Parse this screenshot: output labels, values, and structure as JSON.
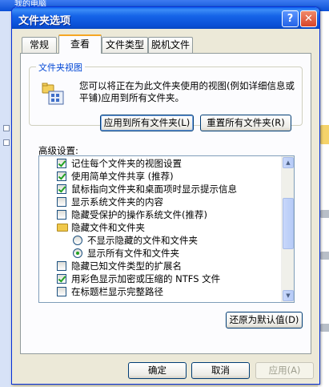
{
  "background": {
    "title": "我的电脑"
  },
  "dialog": {
    "title": "文件夹选项",
    "help_label": "?",
    "close_label": "✕"
  },
  "tabs": [
    {
      "label": "常规"
    },
    {
      "label": "查看"
    },
    {
      "label": "文件类型"
    },
    {
      "label": "脱机文件"
    }
  ],
  "folder_view": {
    "legend": "文件夹视图",
    "description": "您可以将正在为此文件夹使用的视图(例如详细信息或平铺)应用到所有文件夹。",
    "apply_all_label": "应用到所有文件夹(L)",
    "reset_all_label": "重置所有文件夹(R)"
  },
  "advanced": {
    "label": "高级设置:",
    "items": [
      {
        "kind": "checkbox",
        "checked": true,
        "text": "记住每个文件夹的视图设置"
      },
      {
        "kind": "checkbox",
        "checked": true,
        "text": "使用简单文件共享 (推荐)"
      },
      {
        "kind": "checkbox",
        "checked": true,
        "text": "鼠标指向文件夹和桌面项时显示提示信息"
      },
      {
        "kind": "checkbox",
        "checked": false,
        "text": "显示系统文件夹的内容"
      },
      {
        "kind": "checkbox",
        "checked": false,
        "text": "隐藏受保护的操作系统文件(推荐)"
      },
      {
        "kind": "folder",
        "text": "隐藏文件和文件夹"
      },
      {
        "kind": "radio",
        "checked": false,
        "text": "不显示隐藏的文件和文件夹"
      },
      {
        "kind": "radio",
        "checked": true,
        "text": "显示所有文件和文件夹"
      },
      {
        "kind": "checkbox",
        "checked": false,
        "text": "隐藏已知文件类型的扩展名"
      },
      {
        "kind": "checkbox",
        "checked": true,
        "text": "用彩色显示加密或压缩的 NTFS 文件"
      },
      {
        "kind": "checkbox",
        "checked": false,
        "text": "在标题栏显示完整路径"
      }
    ],
    "restore_label": "还原为默认值(D)"
  },
  "footer": {
    "ok_label": "确定",
    "cancel_label": "取消",
    "apply_label": "应用(A)"
  }
}
